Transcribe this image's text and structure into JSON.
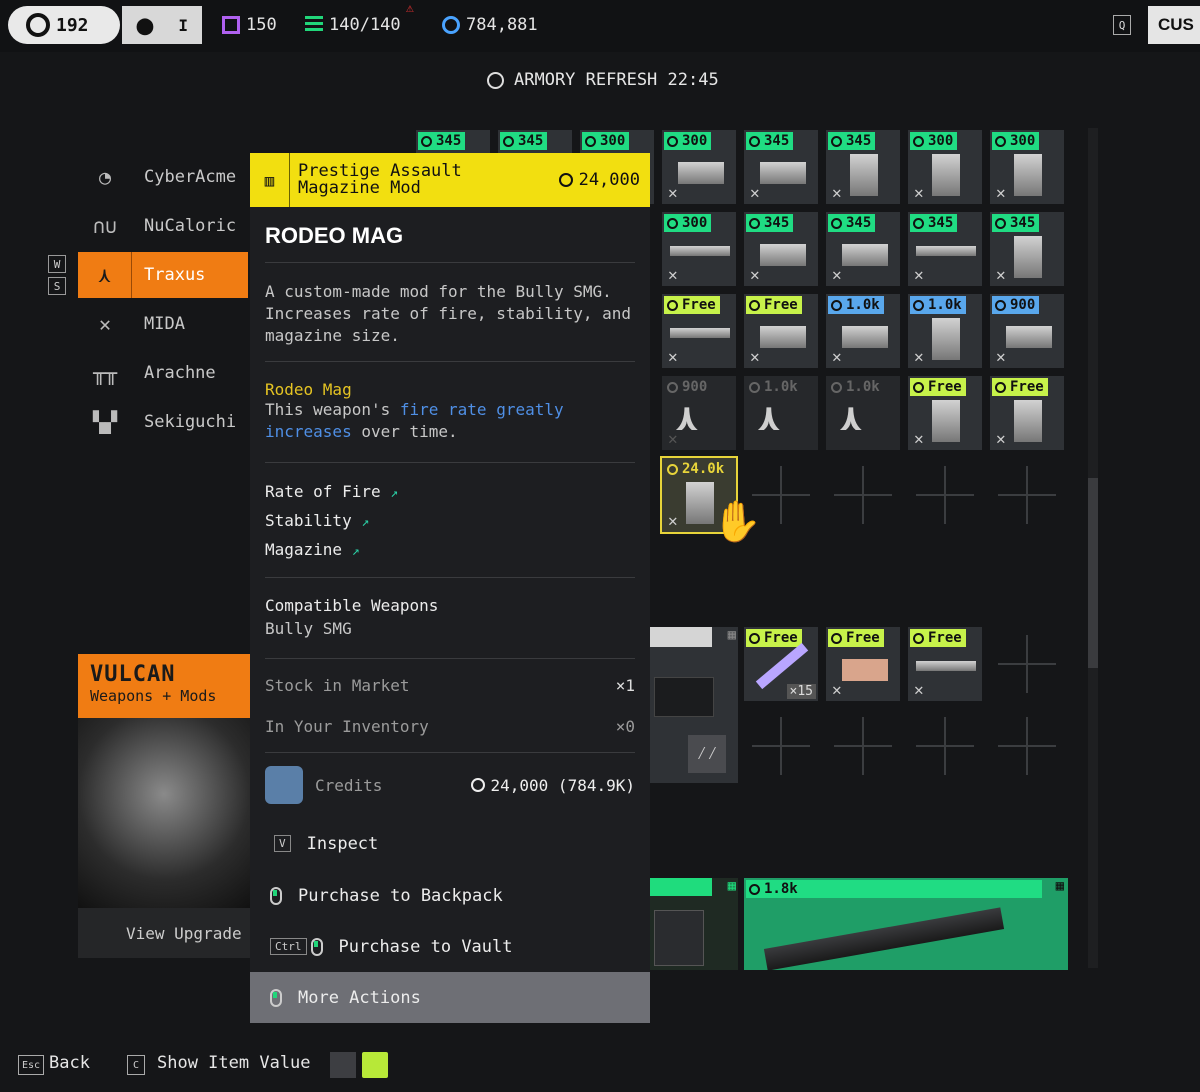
{
  "topbar": {
    "level": "192",
    "tag": "I",
    "purple_currency": "150",
    "green_currency": "140/140",
    "credits": "784,881",
    "hotkey_q": "Q",
    "right_tab": "CUS"
  },
  "refresh": {
    "label": "ARMORY REFRESH 22:45"
  },
  "nav": {
    "key_up": "W",
    "key_down": "S",
    "items": [
      {
        "label": "CyberAcme",
        "icon": "cyberacme-icon"
      },
      {
        "label": "NuCaloric",
        "icon": "nucaloric-icon"
      },
      {
        "label": "Traxus",
        "icon": "traxus-icon",
        "active": true
      },
      {
        "label": "MIDA",
        "icon": "mida-icon"
      },
      {
        "label": "Arachne",
        "icon": "arachne-icon"
      },
      {
        "label": "Sekiguchi",
        "icon": "sekiguchi-icon"
      }
    ]
  },
  "vulcan": {
    "title": "VULCAN",
    "subtitle": "Weapons + Mods",
    "footer": "View Upgrade"
  },
  "grid": {
    "row1": [
      "345",
      "345",
      "300",
      "300",
      "345",
      "345",
      "300",
      "300"
    ],
    "row2": [
      "300",
      "345",
      "345",
      "345",
      "345"
    ],
    "row3": [
      "Free",
      "Free",
      "1.0k",
      "1.0k",
      "900"
    ],
    "row4": [
      "900",
      "1.0k",
      "1.0k",
      "Free",
      "Free"
    ],
    "selected_price": "24.0k",
    "row6": [
      "Free",
      "Free",
      "Free"
    ],
    "qty": "×15",
    "bottom_price": "1.8k"
  },
  "popup": {
    "header_title_line1": "Prestige Assault",
    "header_title_line2": "Magazine Mod",
    "header_price": "24,000",
    "name": "RODEO MAG",
    "description": "A custom-made mod for the Bully SMG. Increases rate of fire, stability, and magazine size.",
    "trait_name": "Rodeo Mag",
    "trait_pre": "This weapon's ",
    "trait_highlight1": "fire rate greatly",
    "trait_highlight2": "increases",
    "trait_post": " over time.",
    "stats": [
      "Rate of Fire",
      "Stability",
      "Magazine"
    ],
    "compatible_label": "Compatible Weapons",
    "compatible_value": "Bully SMG",
    "stock_label": "Stock in Market",
    "stock_value": "×1",
    "inventory_label": "In Your Inventory",
    "inventory_value": "×0",
    "credits_label": "Credits",
    "credits_value": "24,000 (784.9K)",
    "actions": {
      "inspect_key": "V",
      "inspect": "Inspect",
      "backpack": "Purchase to Backpack",
      "vault_key": "Ctrl",
      "vault": "Purchase to Vault",
      "more": "More Actions"
    }
  },
  "bottom": {
    "back_key": "Esc",
    "back": "Back",
    "value_key": "C",
    "show_value": "Show Item Value"
  }
}
